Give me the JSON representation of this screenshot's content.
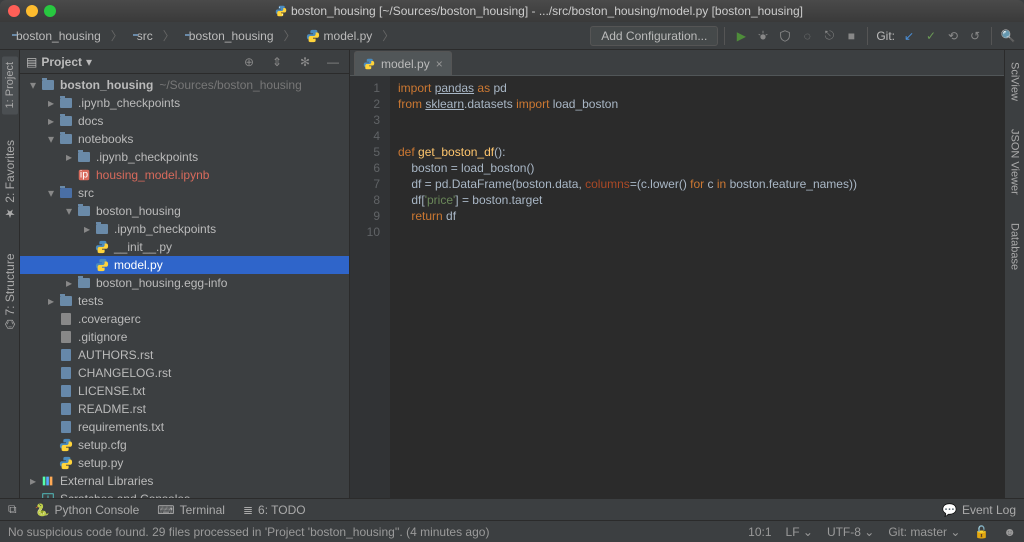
{
  "window": {
    "title": "boston_housing [~/Sources/boston_housing] - .../src/boston_housing/model.py [boston_housing]"
  },
  "breadcrumbs": [
    {
      "label": "boston_housing",
      "icon": "folder"
    },
    {
      "label": "src",
      "icon": "folder"
    },
    {
      "label": "boston_housing",
      "icon": "folder"
    },
    {
      "label": "model.py",
      "icon": "python"
    }
  ],
  "runconfig": {
    "label": "Add Configuration..."
  },
  "git": {
    "label": "Git:"
  },
  "left_tabs": [
    "1: Project",
    "2: Favorites",
    "7: Structure"
  ],
  "right_tabs": [
    "SciView",
    "JSON Viewer",
    "Database"
  ],
  "project_header": {
    "label": "Project"
  },
  "tree": [
    {
      "d": 0,
      "a": "▾",
      "i": "folder",
      "t": "boston_housing",
      "dim": "~/Sources/boston_housing",
      "bold": true
    },
    {
      "d": 1,
      "a": "▸",
      "i": "folder",
      "t": ".ipynb_checkpoints"
    },
    {
      "d": 1,
      "a": "▸",
      "i": "folder",
      "t": "docs"
    },
    {
      "d": 1,
      "a": "▾",
      "i": "folder",
      "t": "notebooks"
    },
    {
      "d": 2,
      "a": "▸",
      "i": "folder",
      "t": ".ipynb_checkpoints"
    },
    {
      "d": 2,
      "a": "",
      "i": "ipynb",
      "t": "housing_model.ipynb",
      "red": true
    },
    {
      "d": 1,
      "a": "▾",
      "i": "src",
      "t": "src"
    },
    {
      "d": 2,
      "a": "▾",
      "i": "folder",
      "t": "boston_housing"
    },
    {
      "d": 3,
      "a": "▸",
      "i": "folder",
      "t": ".ipynb_checkpoints"
    },
    {
      "d": 3,
      "a": "",
      "i": "python",
      "t": "__init__.py"
    },
    {
      "d": 3,
      "a": "",
      "i": "python",
      "t": "model.py",
      "sel": true
    },
    {
      "d": 2,
      "a": "▸",
      "i": "folder",
      "t": "boston_housing.egg-info"
    },
    {
      "d": 1,
      "a": "▸",
      "i": "folder",
      "t": "tests"
    },
    {
      "d": 1,
      "a": "",
      "i": "file",
      "t": ".coveragerc"
    },
    {
      "d": 1,
      "a": "",
      "i": "file",
      "t": ".gitignore"
    },
    {
      "d": 1,
      "a": "",
      "i": "txt",
      "t": "AUTHORS.rst"
    },
    {
      "d": 1,
      "a": "",
      "i": "txt",
      "t": "CHANGELOG.rst"
    },
    {
      "d": 1,
      "a": "",
      "i": "txt",
      "t": "LICENSE.txt"
    },
    {
      "d": 1,
      "a": "",
      "i": "txt",
      "t": "README.rst"
    },
    {
      "d": 1,
      "a": "",
      "i": "txt",
      "t": "requirements.txt"
    },
    {
      "d": 1,
      "a": "",
      "i": "python",
      "t": "setup.cfg"
    },
    {
      "d": 1,
      "a": "",
      "i": "python",
      "t": "setup.py"
    },
    {
      "d": 0,
      "a": "▸",
      "i": "lib",
      "t": "External Libraries"
    },
    {
      "d": 0,
      "a": "",
      "i": "scratch",
      "t": "Scratches and Consoles"
    }
  ],
  "editor_tab": {
    "label": "model.py"
  },
  "code_lines": [
    "1",
    "2",
    "3",
    "4",
    "5",
    "6",
    "7",
    "8",
    "9",
    "10"
  ],
  "code": {
    "l1": {
      "a": "import",
      "b": "pandas",
      "c": "as",
      "d": "pd"
    },
    "l2": {
      "a": "from",
      "b": "sklearn",
      "c": ".datasets",
      "d": "import",
      "e": "load_boston"
    },
    "l5": {
      "a": "def",
      "b": "get_boston_df",
      "c": "():"
    },
    "l6": {
      "a": "boston = load_boston()"
    },
    "l7": {
      "a": "df = pd.DataFrame(boston.data,",
      "b": "columns",
      "c": "=(c.lower()",
      "d": "for",
      "e": "c",
      "f": "in",
      "g": "boston.feature_names))"
    },
    "l8": {
      "a": "df[",
      "b": "'price'",
      "c": "] = boston.target"
    },
    "l9": {
      "a": "return",
      "b": "df"
    }
  },
  "bottom": {
    "python_console": "Python Console",
    "terminal": "Terminal",
    "todo": "6: TODO",
    "event_log": "Event Log"
  },
  "status": {
    "msg": "No suspicious code found. 29 files processed in 'Project 'boston_housing''. (4 minutes ago)",
    "pos": "10:1",
    "lf": "LF",
    "enc": "UTF-8",
    "git": "Git: master"
  }
}
